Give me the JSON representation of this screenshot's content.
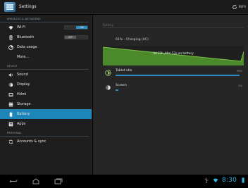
{
  "action_bar": {
    "title": "Settings",
    "right_label": "REFR"
  },
  "sidebar": {
    "sections": [
      {
        "title": "WIRELESS & NETWORKS"
      },
      {
        "title": "DEVICE"
      },
      {
        "title": "PERSONAL"
      }
    ],
    "items": [
      {
        "label": "Wi-Fi",
        "icon": "wifi-icon",
        "toggle": "ON"
      },
      {
        "label": "Bluetooth",
        "icon": "bluetooth-icon",
        "toggle": "OFF"
      },
      {
        "label": "Data usage",
        "icon": "data-usage-icon"
      },
      {
        "label": "More..."
      },
      {
        "label": "Sound",
        "icon": "sound-icon"
      },
      {
        "label": "Display",
        "icon": "display-icon"
      },
      {
        "label": "Hdmi",
        "icon": "hdmi-icon"
      },
      {
        "label": "Storage",
        "icon": "storage-icon"
      },
      {
        "label": "Battery",
        "icon": "battery-icon",
        "selected": true
      },
      {
        "label": "Apps",
        "icon": "apps-icon"
      },
      {
        "label": "Accounts & sync",
        "icon": "sync-icon"
      }
    ]
  },
  "battery": {
    "header": "Battery",
    "status": "61% - Charging (AC)",
    "graph_label": "3d 23h 44m 53s on battery",
    "usage": [
      {
        "name": "Tablet idle",
        "percent": "98%",
        "fraction": 0.98,
        "icon": "tablet-idle-icon"
      },
      {
        "name": "Screen",
        "percent": "2%",
        "fraction": 0.02,
        "icon": "screen-brightness-icon"
      }
    ]
  },
  "system_bar": {
    "clock": "8:30",
    "accent": "#33b5e5"
  },
  "colors": {
    "selected": "#1d85b8",
    "graph_green": "#4a8a2a",
    "usage_bar": "#2f8cc0"
  }
}
